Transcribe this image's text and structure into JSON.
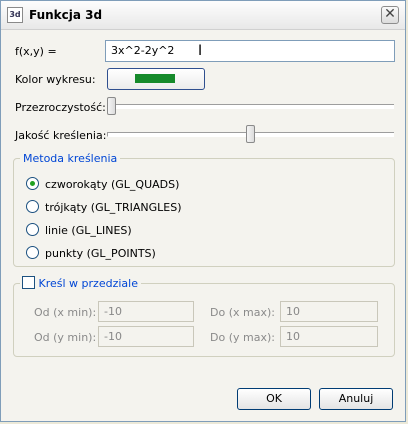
{
  "window": {
    "title": "Funkcja 3d",
    "icon_text": "3d",
    "close_symbol": "✕"
  },
  "function": {
    "label": "f(x,y) =",
    "value": "3x^2-2y^2"
  },
  "color": {
    "label": "Kolor wykresu:",
    "swatch": "#168a2b"
  },
  "transparency": {
    "label": "Przezroczystość:",
    "level": 0.0
  },
  "quality": {
    "label": "Jakość kreślenia:",
    "level": 0.5
  },
  "method": {
    "title": "Metoda kreślenia",
    "options": [
      {
        "label": "czworokąty (GL_QUADS)",
        "selected": true
      },
      {
        "label": "trójkąty (GL_TRIANGLES)",
        "selected": false
      },
      {
        "label": "linie (GL_LINES)",
        "selected": false
      },
      {
        "label": "punkty (GL_POINTS)",
        "selected": false
      }
    ]
  },
  "range": {
    "title": "Kreśl w przedziale",
    "checked": false,
    "x_min_label": "Od (x min):",
    "x_min": "-10",
    "x_max_label": "Do (x max):",
    "x_max": "10",
    "y_min_label": "Od (y min):",
    "y_min": "-10",
    "y_max_label": "Do (y max):",
    "y_max": "10"
  },
  "buttons": {
    "ok": "OK",
    "cancel": "Anuluj"
  }
}
